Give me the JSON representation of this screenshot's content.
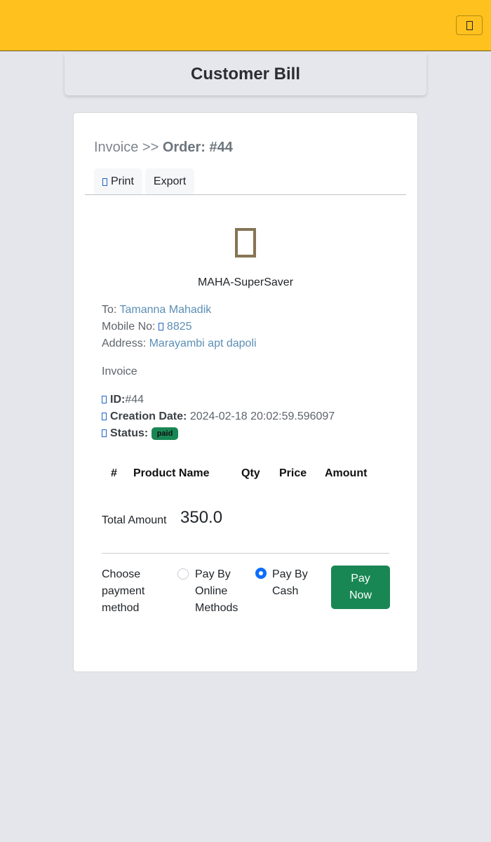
{
  "header": {
    "menu_icon": "menu-icon"
  },
  "page": {
    "title": "Customer Bill"
  },
  "invoice": {
    "breadcrumb_prefix": "Invoice >> ",
    "order_label": "Order: #44",
    "print_label": "Print",
    "export_label": "Export"
  },
  "store": {
    "name": "MAHA-SuperSaver",
    "logo_icon": "store-icon"
  },
  "customer": {
    "to_label": "To: ",
    "name": "Tamanna Mahadik",
    "mobile_label": "Mobile No: ",
    "mobile": "8825",
    "address_label": "Address: ",
    "address": "Marayambi apt dapoli"
  },
  "meta": {
    "heading": "Invoice",
    "id_label": "ID:",
    "id_value": "#44",
    "date_label": "Creation Date:",
    "date_value": "2024-02-18 20:02:59.596097",
    "status_label": "Status:",
    "status_value": "paid",
    "status_color": "#198754"
  },
  "table": {
    "columns": [
      "#",
      "Product Name",
      "Qty",
      "Price",
      "Amount"
    ]
  },
  "totals": {
    "label": "Total Amount",
    "value": "350.0"
  },
  "payment": {
    "label": "Choose payment method",
    "options": [
      {
        "label": "Pay By Online Methods",
        "selected": false
      },
      {
        "label": "Pay By Cash",
        "selected": true
      }
    ],
    "pay_button": "Pay Now",
    "accent": "#0d6efd"
  },
  "colors": {
    "topbar": "#ffc11e",
    "background": "#e4e6eb",
    "button_green": "#198754"
  }
}
